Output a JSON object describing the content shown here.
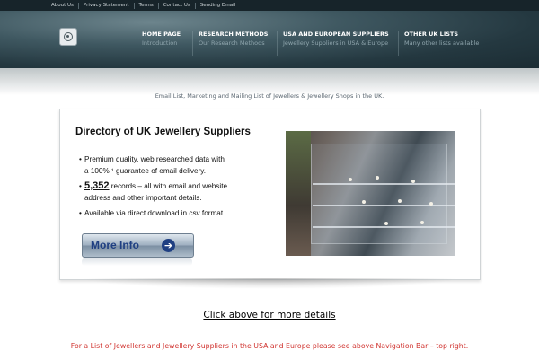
{
  "top_links": [
    "About Us",
    "Privacy Statement",
    "Terms",
    "Contact Us",
    "Sending Email"
  ],
  "nav": [
    {
      "title": "HOME PAGE",
      "subtitle": "Introduction"
    },
    {
      "title": "RESEARCH METHODS",
      "subtitle": "Our Research Methods"
    },
    {
      "title": "USA AND EUROPEAN SUPPLIERS",
      "subtitle": "Jewellery Suppliers in USA & Europe"
    },
    {
      "title": "OTHER UK LISTS",
      "subtitle": "Many other lists available"
    }
  ],
  "tagline": "Email List, Marketing and Mailing List of Jewellers & Jewellery Shops in the UK.",
  "banner": {
    "title": "Directory of UK Jewellery Suppliers",
    "bullet1_line1": "Premium quality, web researched data with",
    "bullet1_line2": "a 100% ¹ guarantee of email delivery.",
    "bullet2_number": "5,352",
    "bullet2_line1_rest": " records – all with email and website",
    "bullet2_line2": "address and other important details.",
    "bullet3": "Available via direct download in csv format .",
    "button_label": "More Info"
  },
  "click_text": "Click above for more details",
  "footer_note": "For a List of Jewellers and Jewellery Suppliers in the USA and Europe please see above Navigation Bar – top right.",
  "colors": {
    "header_dark": "#1b2c33",
    "footer_red": "#d0332f",
    "button_blue": "#1f3f82"
  }
}
